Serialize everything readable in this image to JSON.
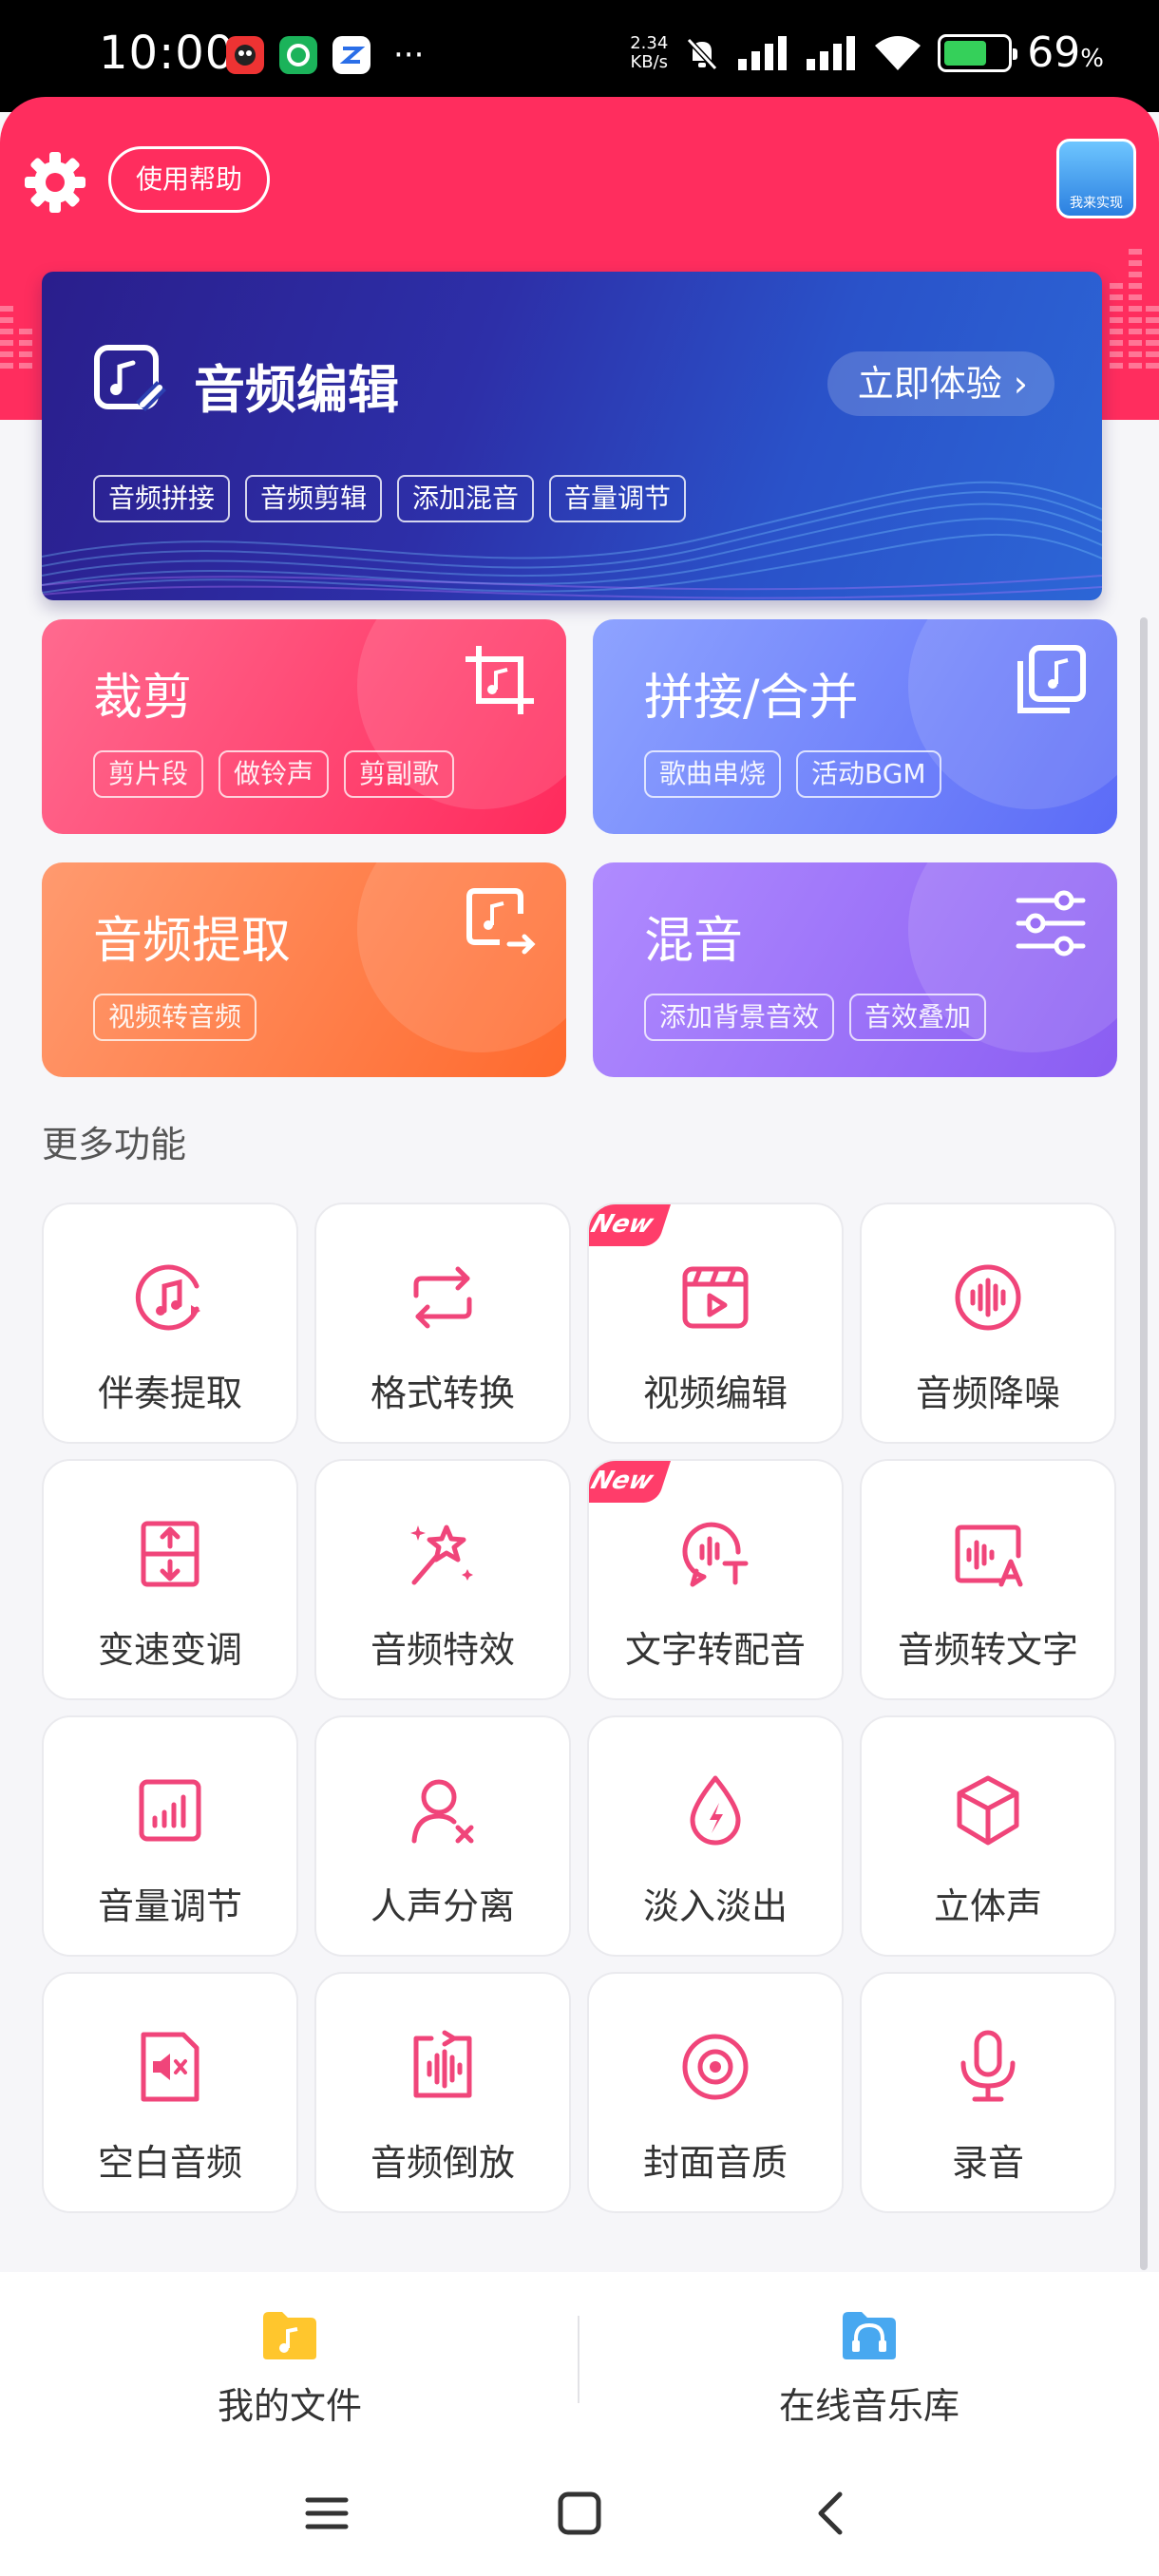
{
  "status_bar": {
    "time": "10:00",
    "more_dots": "···",
    "net_speed_value": "2.34",
    "net_speed_unit": "KB/s",
    "battery_pct": "69",
    "battery_level": 0.69,
    "icons": [
      "app-icon-1",
      "app-icon-2",
      "app-icon-3",
      "mute-bell-icon",
      "signal-icon",
      "signal-icon",
      "wifi-icon",
      "battery-charging-icon"
    ]
  },
  "header": {
    "help_label": "使用帮助",
    "promo_text": "我来实现",
    "accent": "#ff2d5e"
  },
  "banner": {
    "title": "音频编辑",
    "cta_label": "立即体验",
    "tags": [
      "音频拼接",
      "音频剪辑",
      "添加混音",
      "音量调节"
    ]
  },
  "cards": [
    {
      "title": "裁剪",
      "tags": [
        "剪片段",
        "做铃声",
        "剪副歌"
      ],
      "icon": "crop-icon"
    },
    {
      "title": "拼接/合并",
      "tags": [
        "歌曲串烧",
        "活动BGM"
      ],
      "icon": "music-stack-icon"
    },
    {
      "title": "音频提取",
      "tags": [
        "视频转音频"
      ],
      "icon": "music-export-icon"
    },
    {
      "title": "混音",
      "tags": [
        "添加背景音效",
        "音效叠加"
      ],
      "icon": "sliders-icon"
    }
  ],
  "more_section_title": "更多功能",
  "new_badge": "New",
  "tools": [
    {
      "label": "伴奏提取",
      "icon": "accompaniment-extract-icon",
      "is_new": false
    },
    {
      "label": "格式转换",
      "icon": "convert-icon",
      "is_new": false
    },
    {
      "label": "视频编辑",
      "icon": "video-edit-icon",
      "is_new": true
    },
    {
      "label": "音频降噪",
      "icon": "noise-reduction-icon",
      "is_new": false
    },
    {
      "label": "变速变调",
      "icon": "speed-pitch-icon",
      "is_new": false
    },
    {
      "label": "音频特效",
      "icon": "magic-wand-icon",
      "is_new": false
    },
    {
      "label": "文字转配音",
      "icon": "text-to-speech-icon",
      "is_new": true
    },
    {
      "label": "音频转文字",
      "icon": "speech-to-text-icon",
      "is_new": false
    },
    {
      "label": "音量调节",
      "icon": "volume-bars-icon",
      "is_new": false
    },
    {
      "label": "人声分离",
      "icon": "voice-separate-icon",
      "is_new": false
    },
    {
      "label": "淡入淡出",
      "icon": "fade-icon",
      "is_new": false
    },
    {
      "label": "立体声",
      "icon": "stereo-cube-icon",
      "is_new": false
    },
    {
      "label": "空白音频",
      "icon": "silent-audio-icon",
      "is_new": false
    },
    {
      "label": "音频倒放",
      "icon": "reverse-audio-icon",
      "is_new": false
    },
    {
      "label": "封面音质",
      "icon": "disc-icon",
      "is_new": false
    },
    {
      "label": "录音",
      "icon": "microphone-icon",
      "is_new": false
    }
  ],
  "bottom_nav": [
    {
      "label": "我的文件",
      "icon": "folder-music-icon"
    },
    {
      "label": "在线音乐库",
      "icon": "headphones-icon"
    }
  ],
  "colors": {
    "icon_pink": "#f0457a",
    "card_crop": "#ff2a5c",
    "card_merge": "#5b6bf7",
    "card_extract": "#ff6a2e",
    "card_mix": "#8a5df2"
  }
}
